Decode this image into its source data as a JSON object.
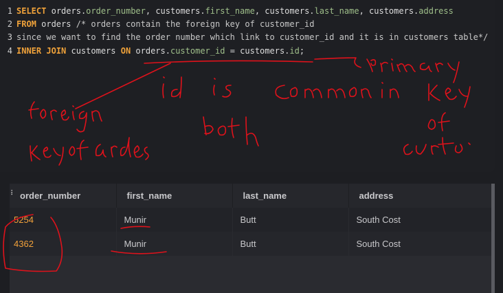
{
  "editor": {
    "lines": [
      {
        "num": "1",
        "parts": [
          {
            "t": "SELECT",
            "c": "kw"
          },
          {
            "t": " ",
            "c": "tx"
          },
          {
            "t": "orders.",
            "c": "tx"
          },
          {
            "t": "order_number",
            "c": "col"
          },
          {
            "t": ", ",
            "c": "tx"
          },
          {
            "t": "customers.",
            "c": "tx"
          },
          {
            "t": "first_name",
            "c": "col"
          },
          {
            "t": ", ",
            "c": "tx"
          },
          {
            "t": "customers.",
            "c": "tx"
          },
          {
            "t": "last_name",
            "c": "col"
          },
          {
            "t": ", ",
            "c": "tx"
          },
          {
            "t": "customers.",
            "c": "tx"
          },
          {
            "t": "address",
            "c": "col"
          }
        ]
      },
      {
        "num": "2",
        "parts": [
          {
            "t": "FROM",
            "c": "kw"
          },
          {
            "t": " orders ",
            "c": "tx"
          },
          {
            "t": "/* orders contain the foreign key of customer_id",
            "c": "cm"
          }
        ]
      },
      {
        "num": "3",
        "parts": [
          {
            "t": "since we want to find the order number which link to customer_id and it is in customers table*/",
            "c": "cm"
          }
        ]
      },
      {
        "num": "4",
        "parts": [
          {
            "t": "INNER JOIN",
            "c": "kw"
          },
          {
            "t": " customers ",
            "c": "tx"
          },
          {
            "t": "ON",
            "c": "kw"
          },
          {
            "t": " orders.",
            "c": "tx"
          },
          {
            "t": "customer_id",
            "c": "col"
          },
          {
            "t": " = customers.",
            "c": "tx"
          },
          {
            "t": "id",
            "c": "col"
          },
          {
            "t": ";",
            "c": "tx"
          }
        ]
      }
    ]
  },
  "results": {
    "handle_glyph": "⠇",
    "columns": [
      "order_number",
      "first_name",
      "last_name",
      "address"
    ],
    "rows": [
      [
        "5254",
        "Munir",
        "Butt",
        "South Cost"
      ],
      [
        "4362",
        "Munir",
        "Butt",
        "South Cost"
      ]
    ]
  },
  "colors": {
    "keyword": "#f0a23a",
    "column": "#9fbf8a",
    "number_cell": "#f2a23b",
    "annotation_ink": "#e0121b"
  },
  "annotations": {
    "handwritten": [
      "primary key of custo",
      "id is common in both",
      "foreign key of orders"
    ]
  }
}
